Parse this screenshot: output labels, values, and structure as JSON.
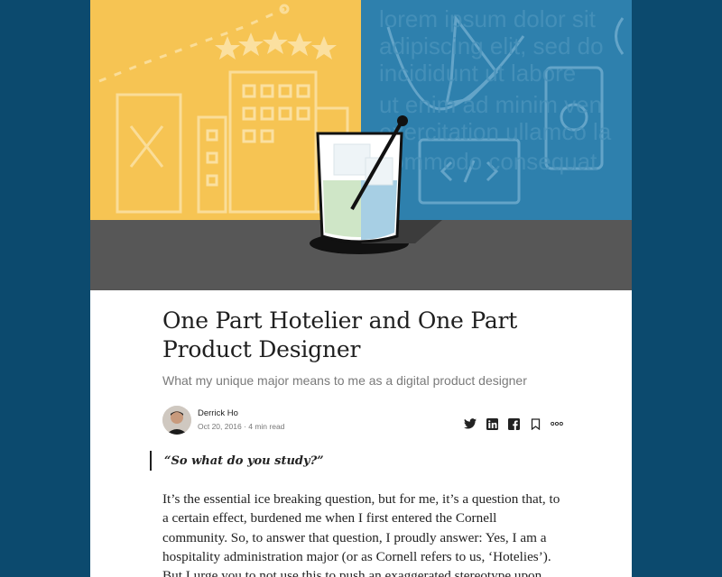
{
  "hero": {
    "banner_text": "lorem ipsum dolor sit adipiscing elit sed do incididunt ut labore ut enim ad minim veniam exercitation ullamco laboris commodo consequat",
    "colors": {
      "left": "#f6c453",
      "right": "#2e80ad",
      "floor": "#575757"
    }
  },
  "article": {
    "title": "One Part Hotelier and One Part Product Designer",
    "subtitle": "What my unique major means to me as a digital product designer",
    "author": "Derrick Ho",
    "date": "Oct 20, 2016",
    "separator": " · ",
    "read_time": "4 min read",
    "pullquote": "“So what do you study?”",
    "body": "It’s the essential ice breaking question, but for me, it’s a question that, to a certain effect, burdened me when I first entered the Cornell community. So, to answer that question, I proudly answer: Yes, I am a hospitality administration major (or as Cornell refers to us, ‘Hotelies’). But I urge you to not use this to push an exaggerated stereotype upon me, or for that matter"
  },
  "share": {
    "icons": [
      "twitter-icon",
      "linkedin-icon",
      "facebook-icon",
      "bookmark-icon",
      "more-icon"
    ]
  }
}
